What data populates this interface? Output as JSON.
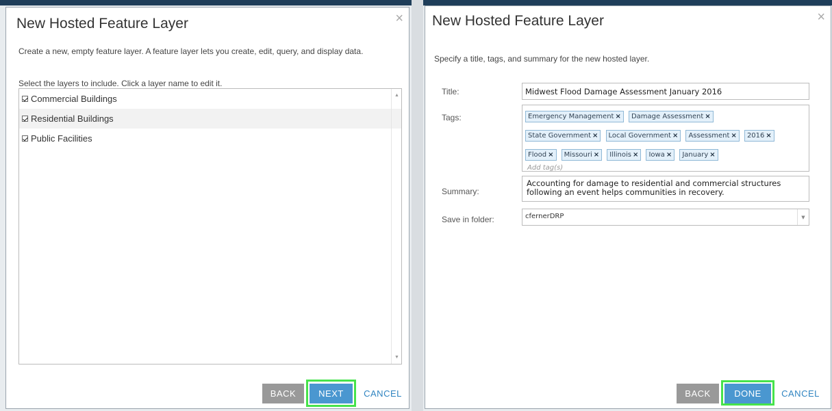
{
  "dialog1": {
    "title": "New Hosted Feature Layer",
    "close_icon": "×",
    "description": "Create a new, empty feature layer. A feature layer lets you create, edit, query, and display data.",
    "select_label": "Select the layers to include. Click a layer name to edit it.",
    "layers": [
      {
        "name": "Commercial Buildings",
        "checked": true
      },
      {
        "name": "Residential Buildings",
        "checked": true
      },
      {
        "name": "Public Facilities",
        "checked": true
      }
    ],
    "buttons": {
      "back": "BACK",
      "next": "NEXT",
      "cancel": "CANCEL"
    }
  },
  "dialog2": {
    "title": "New Hosted Feature Layer",
    "close_icon": "×",
    "intro": "Specify a title, tags, and summary for the new hosted layer.",
    "fields": {
      "title_label": "Title:",
      "title_value": "Midwest Flood Damage Assessment January 2016",
      "tags_label": "Tags:",
      "tags": [
        "Emergency Management",
        "Damage Assessment",
        "State Government",
        "Local Government",
        "Assessment",
        "2016",
        "Flood",
        "Missouri",
        "Illinois",
        "Iowa",
        "January"
      ],
      "tag_remove": "×",
      "add_tag_placeholder": "Add tag(s)",
      "summary_label": "Summary:",
      "summary_value": "Accounting for damage to residential and commercial structures following an event helps communities in recovery.",
      "folder_label": "Save in folder:",
      "folder_value": "cfernerDRP"
    },
    "buttons": {
      "back": "BACK",
      "done": "DONE",
      "cancel": "CANCEL"
    }
  },
  "colors": {
    "primary": "#4a97d0",
    "back": "#999999",
    "link": "#2f84c1",
    "highlight": "#46e34b"
  }
}
